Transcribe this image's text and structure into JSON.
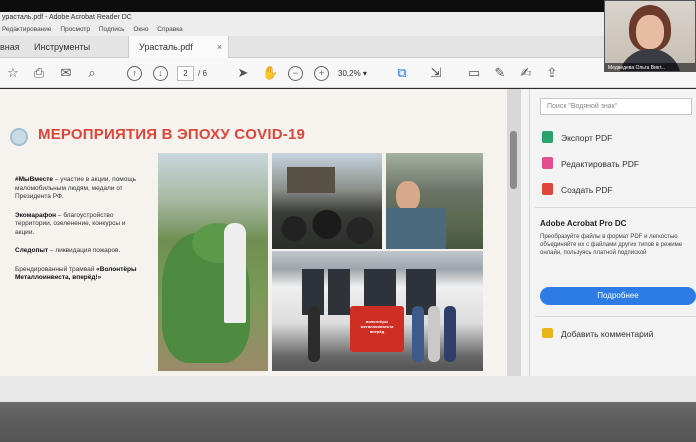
{
  "window": {
    "title": "урасталь.pdf - Adobe Acrobat Reader DC"
  },
  "menu": [
    "Редактирование",
    "Просмотр",
    "Подпись",
    "Окно",
    "Справка"
  ],
  "tabs": [
    {
      "label": "вная"
    },
    {
      "label": "Инструменты"
    },
    {
      "label": "Урасталь.pdf",
      "close": "×"
    }
  ],
  "toolbar": {
    "page_current": "2",
    "page_total": "/ 6",
    "zoom": "30,2%"
  },
  "slide": {
    "title": "МЕРОПРИЯТИЯ В ЭПОХУ COVID-19",
    "bullets": [
      {
        "bold": "#МыВместе",
        "text": " – участие в акции, помощь маломобильным людям, медали от Президента РФ."
      },
      {
        "bold": "Экомарафон",
        "text": " – благоустройство территории, озеленение, конкурсы и акции."
      },
      {
        "bold": "Следопыт",
        "text": " – ликвидация пожаров."
      },
      {
        "bold": "",
        "text": "Брендированный трамвай "
      },
      {
        "bold": "«Волонтёры Металлоинвеста, вперёд!»",
        "text": ""
      }
    ],
    "tram_banner": "волонтёры металлоинвеста вперёд"
  },
  "right_panel": {
    "search_placeholder": "Поиск \"Водяной знак\"",
    "tools": [
      {
        "label": "Экспорт PDF",
        "color": "#2aa36b"
      },
      {
        "label": "Редактировать PDF",
        "color": "#e24f8f"
      },
      {
        "label": "Создать PDF",
        "color": "#e0453a"
      }
    ],
    "promo_title": "Adobe Acrobat Pro DC",
    "promo_text": "Преобразуйте файлы в формат PDF и легкостью объединяйте их с файлами других типов в режиме онлайн, пользуясь платной подпиской",
    "promo_button": "Подробнее",
    "comment_label": "Добавить комментарий"
  },
  "webcam": {
    "name": "Медведева Ольга Викт..."
  }
}
